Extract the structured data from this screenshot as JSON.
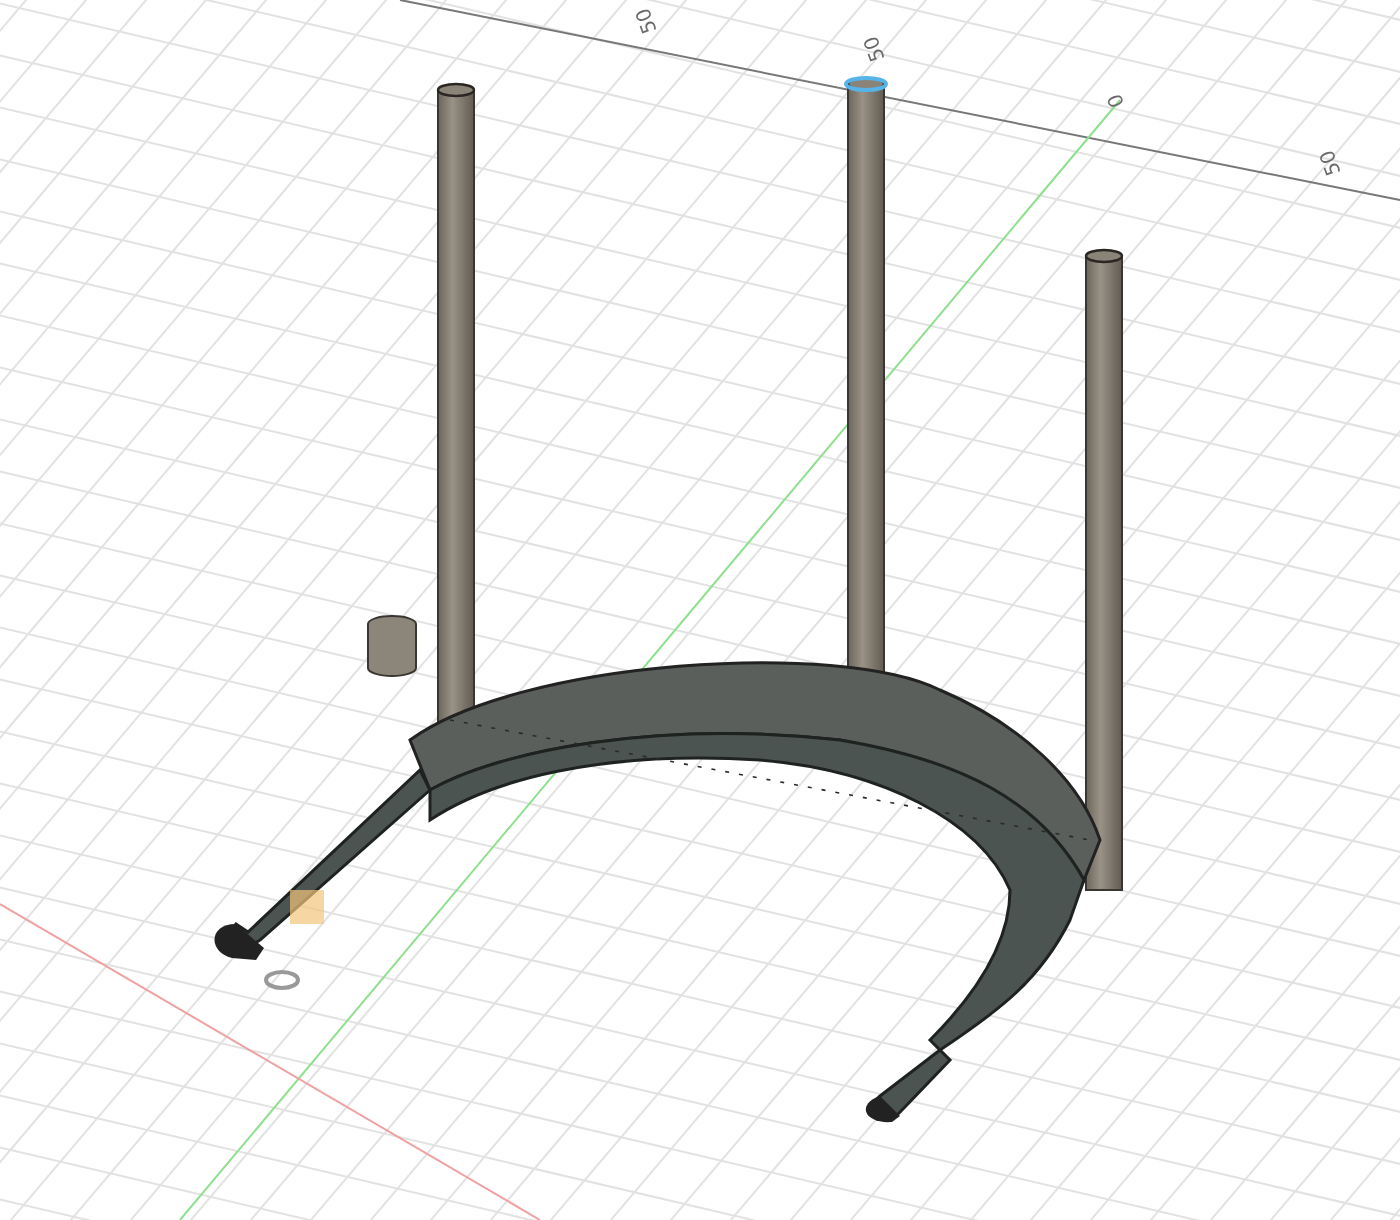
{
  "viewport": {
    "axis_labels": [
      {
        "text": "50"
      },
      {
        "text": "50"
      },
      {
        "text": "0"
      },
      {
        "text": "50"
      }
    ]
  }
}
